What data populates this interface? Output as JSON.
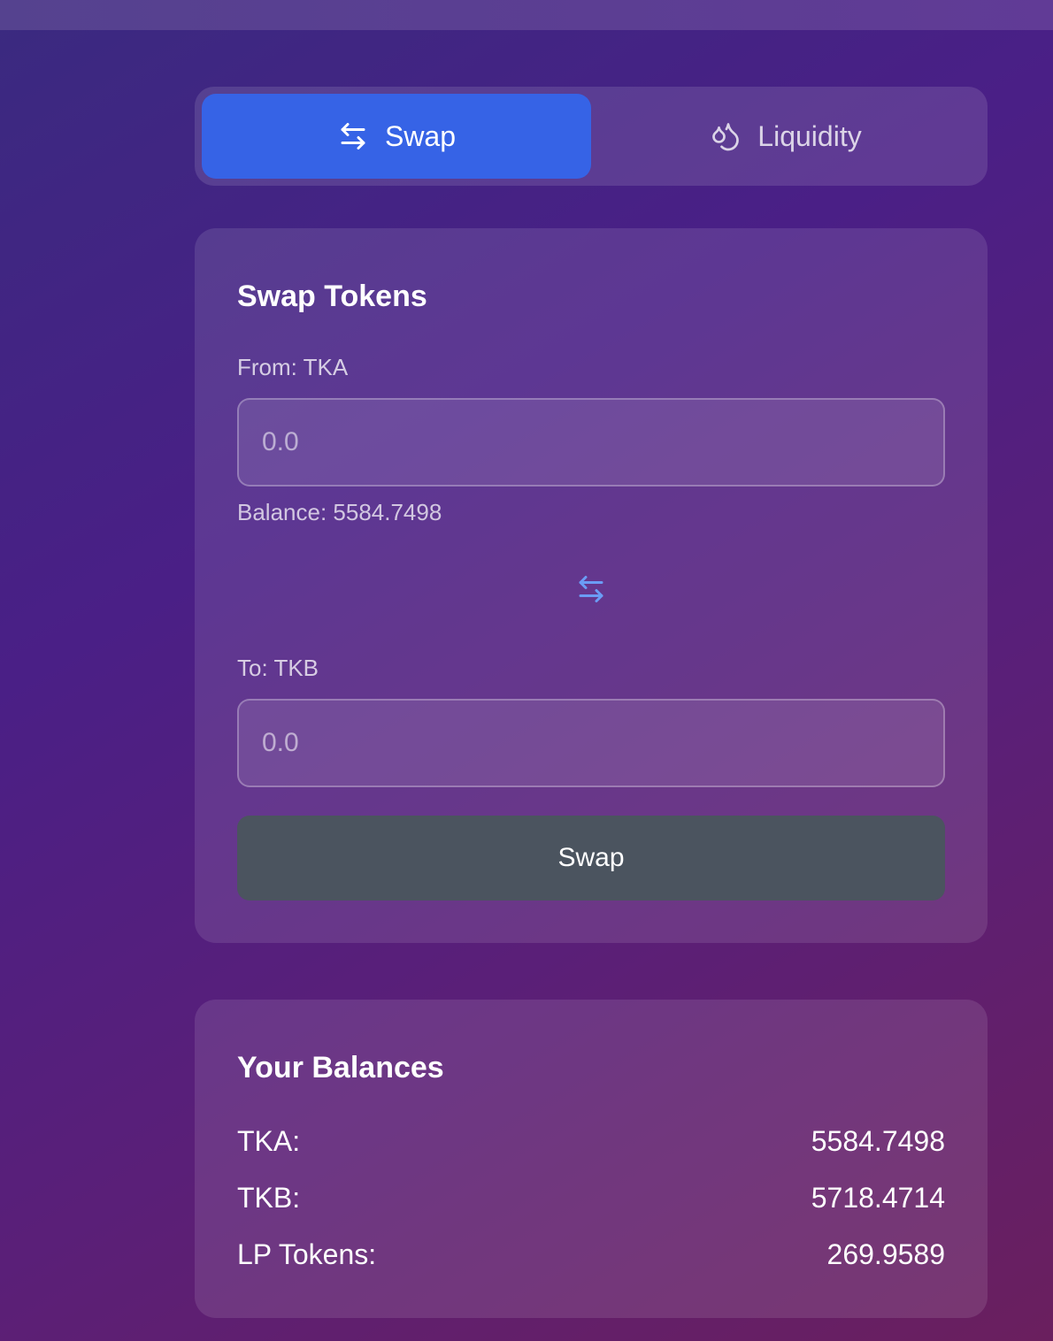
{
  "tabs": [
    {
      "label": "Swap",
      "icon": "arrows-swap-icon",
      "active": true
    },
    {
      "label": "Liquidity",
      "icon": "droplets-icon",
      "active": false
    }
  ],
  "swap": {
    "title": "Swap Tokens",
    "from_label": "From: TKA",
    "from_placeholder": "0.0",
    "from_balance": "Balance: 5584.7498",
    "to_label": "To: TKB",
    "to_placeholder": "0.0",
    "button_label": "Swap"
  },
  "balances": {
    "title": "Your Balances",
    "rows": [
      {
        "label": "TKA:",
        "value": "5584.7498"
      },
      {
        "label": "TKB:",
        "value": "5718.4714"
      },
      {
        "label": "LP Tokens:",
        "value": "269.9589"
      }
    ]
  },
  "colors": {
    "active_tab": "#3663e6",
    "swap_button": "#4b545f",
    "accent_icon": "#6b9cf5"
  }
}
